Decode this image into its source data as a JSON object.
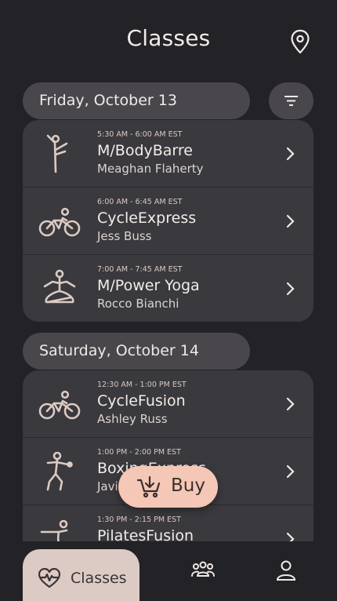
{
  "header": {
    "title": "Classes",
    "location_icon": "map-pin-icon"
  },
  "sections": [
    {
      "date": "Friday, October 13",
      "classes": [
        {
          "time": "5:30 AM - 6:00 AM EST",
          "name": "M/BodyBarre",
          "instructor": "Meaghan Flaherty",
          "icon": "barre-icon"
        },
        {
          "time": "6:00 AM - 6:45 AM EST",
          "name": "CycleExpress",
          "instructor": "Jess Buss",
          "icon": "cycling-icon"
        },
        {
          "time": "7:00 AM - 7:45 AM EST",
          "name": "M/Power Yoga",
          "instructor": "Rocco Bianchi",
          "icon": "yoga-icon"
        }
      ]
    },
    {
      "date": "Saturday, October 14",
      "classes": [
        {
          "time": "12:30 AM - 1:00 PM EST",
          "name": "CycleFusion",
          "instructor": "Ashley Russ",
          "icon": "cycling-icon"
        },
        {
          "time": "1:00 PM - 2:00 PM EST",
          "name": "BoxingExpress",
          "instructor": "Javier",
          "icon": "boxing-icon"
        },
        {
          "time": "1:30 PM - 2:15 PM EST",
          "name": "PilatesFusion",
          "instructor": "",
          "icon": "pilates-icon"
        }
      ]
    }
  ],
  "buy_button": {
    "label": "Buy"
  },
  "bottom_nav": {
    "classes_label": "Classes"
  },
  "colors": {
    "background": "#232226",
    "card": "#3a393d",
    "pill": "#49474c",
    "accent": "#f4c7b6",
    "icon": "#dccbc4"
  }
}
